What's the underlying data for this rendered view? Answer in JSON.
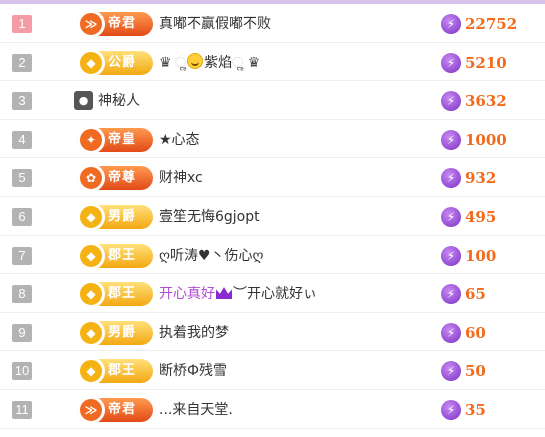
{
  "ranking": [
    {
      "rank": "1",
      "rank_style": "top",
      "badge": "帝君",
      "badge_color": "red",
      "name": "真嘟不赢假嘟不败",
      "name_style": "normal",
      "score": "22752"
    },
    {
      "rank": "2",
      "rank_style": "normal",
      "badge": "公爵",
      "badge_color": "gold",
      "name_parts": [
        "♛ ",
        "ૢ",
        "紫焰",
        "ૢ ♛"
      ],
      "name_style": "decorated",
      "score": "5210"
    },
    {
      "rank": "3",
      "rank_style": "normal",
      "badge": "",
      "badge_color": "",
      "name": "神秘人",
      "name_style": "anonymous",
      "score": "3632"
    },
    {
      "rank": "4",
      "rank_style": "normal",
      "badge": "帝皇",
      "badge_color": "red",
      "name": "★心态",
      "name_style": "normal",
      "score": "1000"
    },
    {
      "rank": "5",
      "rank_style": "normal",
      "badge": "帝尊",
      "badge_color": "red",
      "name": "财神xc",
      "name_style": "normal",
      "score": "932"
    },
    {
      "rank": "6",
      "rank_style": "normal",
      "badge": "男爵",
      "badge_color": "gold",
      "name": "壹笙无悔6gjopt",
      "name_style": "normal",
      "score": "495"
    },
    {
      "rank": "7",
      "rank_style": "normal",
      "badge": "郡王",
      "badge_color": "gold",
      "name": "ღ听涛♥丶伤心ღ",
      "name_style": "normal",
      "score": "100"
    },
    {
      "rank": "8",
      "rank_style": "normal",
      "badge": "郡王",
      "badge_color": "gold",
      "name_parts": [
        "开心真好",
        "︶",
        "开心就好ぃ"
      ],
      "name_style": "vip",
      "score": "65"
    },
    {
      "rank": "9",
      "rank_style": "normal",
      "badge": "男爵",
      "badge_color": "gold",
      "name": "执着我的梦",
      "name_style": "normal",
      "score": "60"
    },
    {
      "rank": "10",
      "rank_style": "normal",
      "badge": "郡王",
      "badge_color": "gold",
      "name": "断桥Ф残雪",
      "name_style": "normal",
      "score": "50"
    },
    {
      "rank": "11",
      "rank_style": "normal",
      "badge": "帝君",
      "badge_color": "red",
      "name": "...来自天堂.",
      "name_style": "normal",
      "score": "35"
    }
  ],
  "icons": {
    "score": "lightning-icon",
    "badge_emblem": "rank-emblem-icon",
    "anonymous": "mystery-person-icon"
  },
  "colors": {
    "score": "#f26a1b",
    "rank_top": "#f59aa7",
    "rank_normal": "#b3b3b3",
    "vip_name": "#b24bd6",
    "badge_red": "#e24a18",
    "badge_gold": "#f3a812",
    "lightning": "#7b2fc4"
  }
}
